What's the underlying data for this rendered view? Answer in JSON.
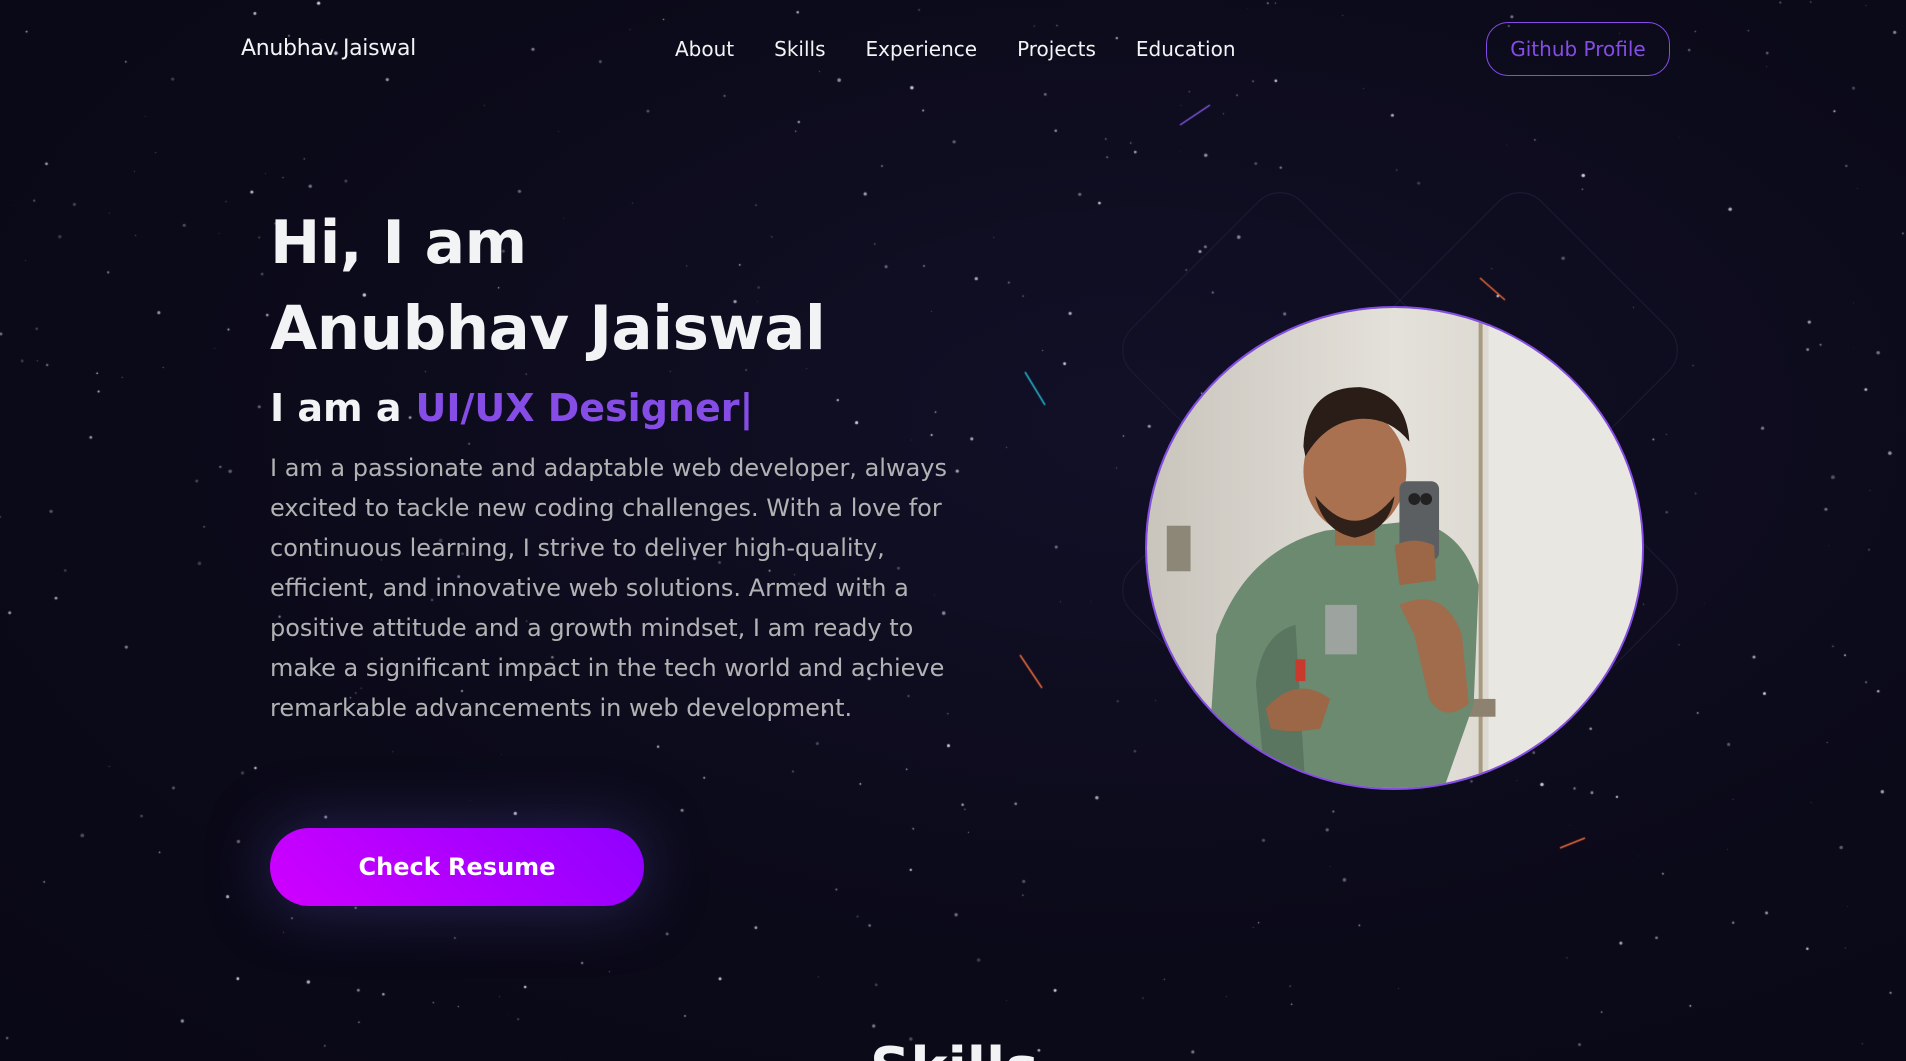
{
  "nav": {
    "brand": "Anubhav Jaiswal",
    "links": [
      "About",
      "Skills",
      "Experience",
      "Projects",
      "Education"
    ],
    "github_label": "Github Profile"
  },
  "hero": {
    "line1": "Hi, I am",
    "line2": "Anubhav Jaiswal",
    "role_prefix": "I am a",
    "role_typed": "UI/UX Designer|",
    "description": "I am a passionate and adaptable web developer, always excited to tackle new coding challenges. With a love for continuous learning, I strive to deliver high-quality, efficient, and innovative web solutions. Armed with a positive attitude and a growth mindset, I am ready to make a significant impact in the tech world and achieve remarkable advancements in web development.",
    "cta_label": "Check Resume",
    "photo_icon": "profile-photo"
  },
  "next_section": {
    "title": "Skills"
  },
  "colors": {
    "background": "#0c0a1b",
    "accent": "#854ce6",
    "text_primary": "#f2f3f4",
    "text_secondary": "#b1b2b3",
    "cta_gradient_start": "#d000ff",
    "cta_gradient_end": "#8f00ff"
  }
}
